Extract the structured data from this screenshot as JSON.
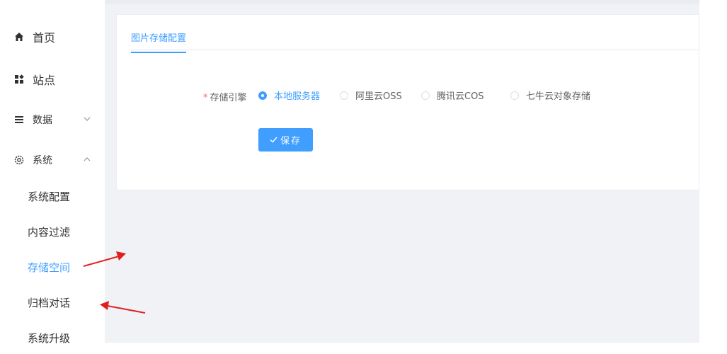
{
  "sidebar": {
    "items": [
      {
        "label": "首页",
        "icon": "home-icon"
      },
      {
        "label": "站点",
        "icon": "grid-icon"
      },
      {
        "label": "数据",
        "icon": "list-icon"
      },
      {
        "label": "系统",
        "icon": "gear-icon"
      }
    ],
    "system_sub": [
      {
        "label": "系统配置"
      },
      {
        "label": "内容过滤"
      },
      {
        "label": "存储空间",
        "active": true
      },
      {
        "label": "归档对话"
      },
      {
        "label": "系统升级"
      }
    ]
  },
  "main": {
    "tab": "图片存储配置",
    "form": {
      "required_mark": "*",
      "label": "存储引擎",
      "options": [
        "本地服务器",
        "阿里云OSS",
        "腾讯云COS",
        "七牛云对象存储"
      ],
      "selected": "本地服务器"
    },
    "save_label": "保存"
  },
  "colors": {
    "accent": "#409eff",
    "annotation_arrow": "#e02020"
  }
}
